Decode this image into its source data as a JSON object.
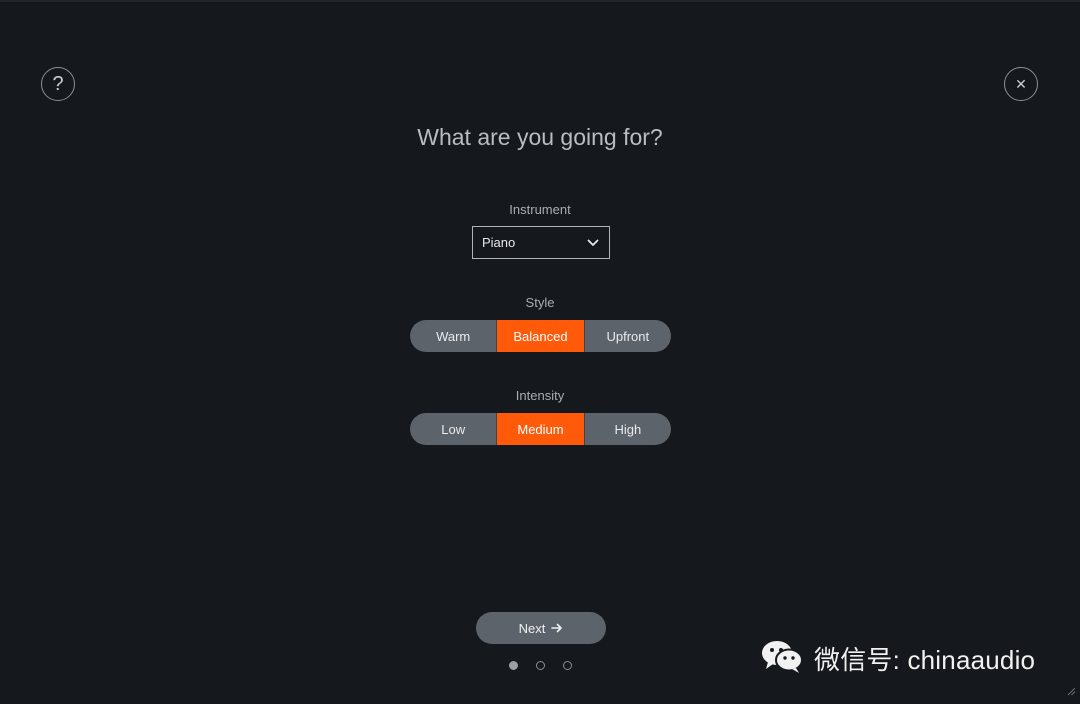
{
  "title": "What are you going for?",
  "instrument": {
    "label": "Instrument",
    "selected": "Piano"
  },
  "style": {
    "label": "Style",
    "options": [
      "Warm",
      "Balanced",
      "Upfront"
    ],
    "selected": "Balanced"
  },
  "intensity": {
    "label": "Intensity",
    "options": [
      "Low",
      "Medium",
      "High"
    ],
    "selected": "Medium"
  },
  "next_label": "Next",
  "pagination": {
    "total": 3,
    "current": 1
  },
  "watermark": "微信号: chinaaudio",
  "icons": {
    "help": "question-mark-icon",
    "close": "close-icon",
    "dropdown": "chevron-down-icon",
    "next": "arrow-right-icon"
  },
  "colors": {
    "accent": "#ff5a0a",
    "background": "#15181c",
    "segment": "#5d636a"
  }
}
